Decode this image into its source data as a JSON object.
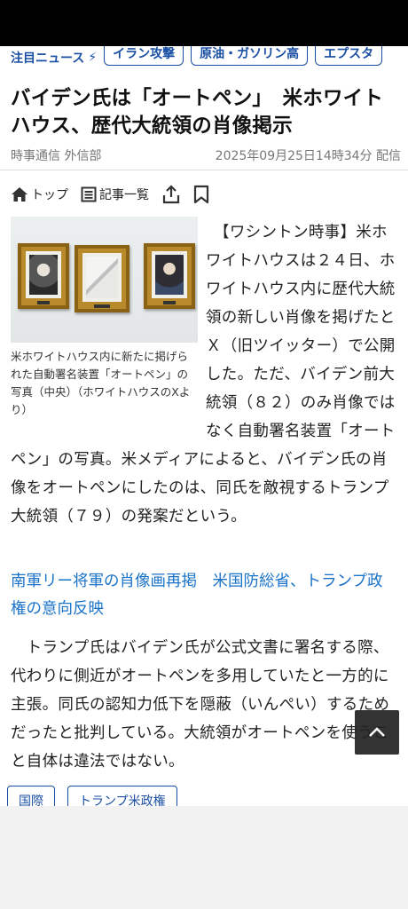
{
  "topics": {
    "label": "注目ニュース",
    "chips": [
      "イラン攻撃",
      "原油・ガソリン高",
      "エプスタ"
    ]
  },
  "article": {
    "headline": "バイデン氏は「オートペン」　米ホワイトハウス、歴代大統領の肖像掲示",
    "source": "時事通信 外信部",
    "datetime": "2025年09月25日14時34分 配信",
    "toolbar": {
      "top": "トップ",
      "article_list": "記事一覧"
    },
    "photo_caption": "米ホワイトハウス内に新たに掲げられた自動署名装置「オートペン」の写真（中央）（ホワイトハウスのXより）",
    "paragraph1": "　【ワシントン時事】米ホワイトハウスは２４日、ホワイトハウス内に歴代大統領の新しい肖像を掲げたとＸ（旧ツイッター）で公開した。ただ、バイデン前大統領（８２）のみ肖像ではなく自動署名装置「オートペン」の写真。米メディアによると、バイデン氏の肖像をオートペンにしたのは、同氏を敵視するトランプ大統領（７９）の発案だという。",
    "related_link": "南軍リー将軍の肖像画再掲　米国防総省、トランプ政権の意向反映",
    "paragraph2": "　トランプ氏はバイデン氏が公式文書に署名する際、代わりに側近がオートペンを多用していたと一方的に主張。同氏の認知力低下を隠蔽（いんぺい）するためだったと批判している。大統領がオートペンを使うこと自体は違法ではない。",
    "tags": [
      "国際",
      "トランプ米政権"
    ]
  },
  "colors": {
    "accent": "#1a4fa3",
    "link": "#1a73c9"
  }
}
